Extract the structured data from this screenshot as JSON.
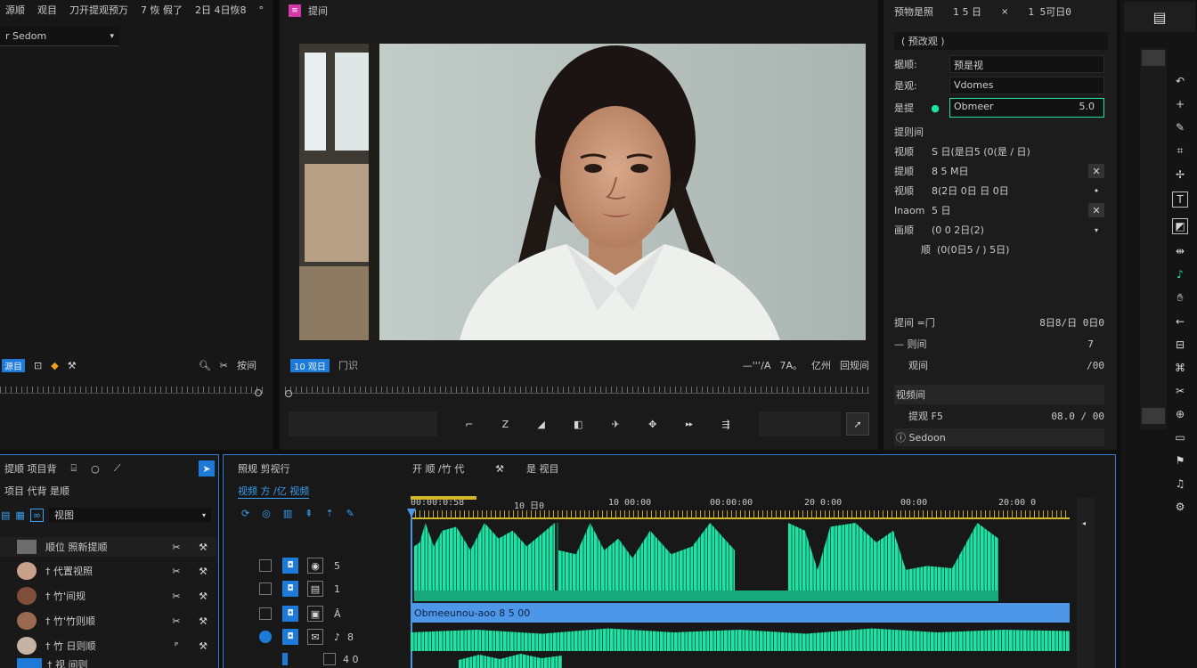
{
  "source_panel": {
    "title_items": [
      "源顺",
      "观目",
      "刀开提观预万",
      "7  恢 假了",
      "2日 4日恢8",
      "°"
    ],
    "dropdown_value": "r Sedom",
    "bottom_left_label": "源目",
    "bottom_right_label": "按间"
  },
  "program_panel": {
    "title": "提间",
    "left_label": "10 观日",
    "left_label2": "冂识",
    "right_labels": [
      "—''‘/A",
      "7A。",
      "亿州",
      "回规间"
    ]
  },
  "inspector": {
    "header": [
      "预物是照",
      "1 5 日",
      "1 5可日0"
    ],
    "subheader": "( 预改观 )",
    "rows": [
      {
        "label": "据顺:",
        "value": "预是视"
      },
      {
        "label": "是观:",
        "value": "Vdomes"
      },
      {
        "label": "是提",
        "value": "Obmeer",
        "extra": "5.0"
      }
    ],
    "section_title": "提则间",
    "props": [
      {
        "label": "视顺",
        "value": "S 日(是日5 (0(是 / 日)"
      },
      {
        "label": "提顺",
        "value": "8 5 M日"
      },
      {
        "label": "视顺",
        "value": "8(2日 0日 日 0日"
      },
      {
        "label": "Inaom",
        "value": "5 日"
      },
      {
        "label": "画顺",
        "value": "(0 0 2日(2)"
      },
      {
        "label": "顺",
        "value": "(0(0日5 / ) 5日)"
      }
    ],
    "bottom_rows": [
      {
        "label": "提间 =门",
        "value": "8日8/日 0日0"
      },
      {
        "label": "— 则间",
        "value": "7"
      },
      {
        "label": "观间",
        "value": "/00"
      }
    ],
    "section2": "视频间",
    "row2": {
      "label": "提观 F5",
      "value": "08.0 / 00"
    },
    "footer": "ⓘ Sedoon"
  },
  "project_panel": {
    "title": "提顺 项目背",
    "subtitle": "项目 代背 是顺",
    "tool_label": "视图",
    "rows": [
      "顺位 照新提顺",
      "† 代置视照",
      "† 竹'间规",
      "† 竹'竹则顺",
      "† 竹 日则顺",
      "† 视 间则"
    ]
  },
  "timeline": {
    "title": "照规 剪视行",
    "label2": "开 顺 /竹 代",
    "label3": "是 视目",
    "tab": "视频 方 /亿 视频",
    "timecodes": [
      "00:00:0:58",
      "10 日0",
      "10 00:00",
      "00:00:00",
      "20 0:00",
      "00:00",
      "20:00 0"
    ],
    "track_numbers": [
      "5",
      "1",
      "Â",
      "8",
      "4 0"
    ],
    "clip_label": "Obmeeunou-aoo 8 5 00"
  },
  "colors": {
    "accent_blue": "#2f7fd3",
    "wave_green": "#1fe3a6",
    "clip_blue": "#4d96e8",
    "playhead_yellow": "#d4b82b"
  }
}
